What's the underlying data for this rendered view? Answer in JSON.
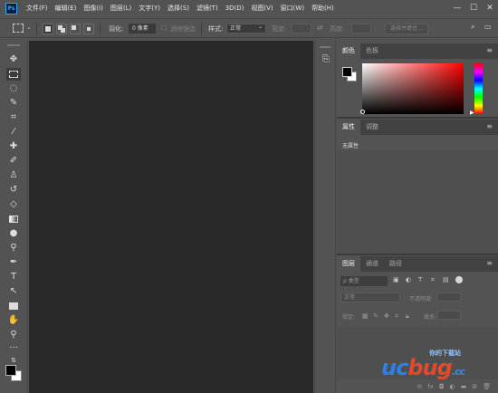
{
  "app": {
    "logo_text": "Ps"
  },
  "menu": [
    "文件(F)",
    "编辑(E)",
    "图像(I)",
    "图层(L)",
    "文字(Y)",
    "选择(S)",
    "滤镜(T)",
    "3D(D)",
    "视图(V)",
    "窗口(W)",
    "帮助(H)"
  ],
  "window_controls": {
    "minimize": "—",
    "maximize": "☐",
    "close": "✕"
  },
  "options": {
    "feather_label": "羽化:",
    "feather_value": "0 像素",
    "antialias_label": "消除锯齿",
    "style_label": "样式:",
    "style_value": "正常",
    "width_label": "宽度:",
    "height_label": "高度:",
    "select_mask_button": "选择并遮住..."
  },
  "color_panel": {
    "tabs": [
      "颜色",
      "色板"
    ],
    "foreground_color": "#000000",
    "background_color": "#ffffff"
  },
  "properties_panel": {
    "tabs": [
      "属性",
      "调整"
    ],
    "empty_text": "无属性"
  },
  "layers_panel": {
    "tabs": [
      "图层",
      "通道",
      "路径"
    ],
    "search_placeholder": "ρ 类型",
    "blend_mode": "正常",
    "opacity_label": "不透明度:",
    "lock_label": "锁定:",
    "fill_label": "填充:",
    "footer_icons": [
      "link-icon",
      "fx-icon",
      "mask-icon",
      "adjustment-icon",
      "folder-icon",
      "new-layer-icon",
      "trash-icon"
    ]
  },
  "watermark": {
    "tagline": "你的下载站",
    "brand_left": "uc",
    "brand_right": "bug",
    "tld": ".cc"
  }
}
